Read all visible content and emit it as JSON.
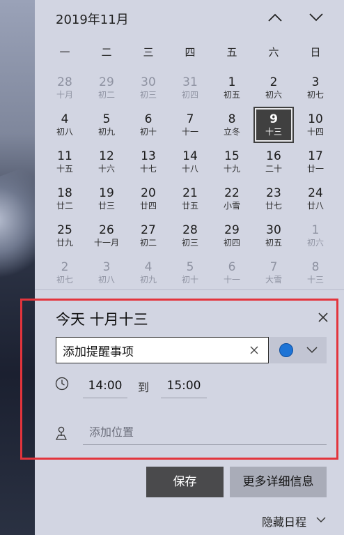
{
  "calendar": {
    "month_title": "2019年11月",
    "weekdays": [
      "一",
      "二",
      "三",
      "四",
      "五",
      "六",
      "日"
    ],
    "weeks": [
      [
        {
          "n": "28",
          "l": "十月",
          "o": true
        },
        {
          "n": "29",
          "l": "初二",
          "o": true
        },
        {
          "n": "30",
          "l": "初三",
          "o": true
        },
        {
          "n": "31",
          "l": "初四",
          "o": true
        },
        {
          "n": "1",
          "l": "初五"
        },
        {
          "n": "2",
          "l": "初六"
        },
        {
          "n": "3",
          "l": "初七"
        }
      ],
      [
        {
          "n": "4",
          "l": "初八"
        },
        {
          "n": "5",
          "l": "初九"
        },
        {
          "n": "6",
          "l": "初十"
        },
        {
          "n": "7",
          "l": "十一"
        },
        {
          "n": "8",
          "l": "立冬"
        },
        {
          "n": "9",
          "l": "十三",
          "today": true
        },
        {
          "n": "10",
          "l": "十四"
        }
      ],
      [
        {
          "n": "11",
          "l": "十五"
        },
        {
          "n": "12",
          "l": "十六"
        },
        {
          "n": "13",
          "l": "十七"
        },
        {
          "n": "14",
          "l": "十八"
        },
        {
          "n": "15",
          "l": "十九"
        },
        {
          "n": "16",
          "l": "二十"
        },
        {
          "n": "17",
          "l": "廿一"
        }
      ],
      [
        {
          "n": "18",
          "l": "廿二"
        },
        {
          "n": "19",
          "l": "廿三"
        },
        {
          "n": "20",
          "l": "廿四"
        },
        {
          "n": "21",
          "l": "廿五"
        },
        {
          "n": "22",
          "l": "小雪"
        },
        {
          "n": "23",
          "l": "廿七"
        },
        {
          "n": "24",
          "l": "廿八"
        }
      ],
      [
        {
          "n": "25",
          "l": "廿九"
        },
        {
          "n": "26",
          "l": "十一月"
        },
        {
          "n": "27",
          "l": "初二"
        },
        {
          "n": "28",
          "l": "初三"
        },
        {
          "n": "29",
          "l": "初四"
        },
        {
          "n": "30",
          "l": "初五"
        },
        {
          "n": "1",
          "l": "初六",
          "o": true
        }
      ],
      [
        {
          "n": "2",
          "l": "初七",
          "o": true
        },
        {
          "n": "3",
          "l": "初八",
          "o": true
        },
        {
          "n": "4",
          "l": "初九",
          "o": true
        },
        {
          "n": "5",
          "l": "初十",
          "o": true
        },
        {
          "n": "6",
          "l": "十一",
          "o": true
        },
        {
          "n": "7",
          "l": "大雪",
          "o": true
        },
        {
          "n": "8",
          "l": "十三",
          "o": true
        }
      ]
    ]
  },
  "event": {
    "title": "今天 十月十三",
    "reminder_value": "添加提醒事项",
    "color": "#1e74d6",
    "start_time": "14:00",
    "to_label": "到",
    "end_time": "15:00",
    "location_placeholder": "添加位置"
  },
  "buttons": {
    "save": "保存",
    "more_details": "更多详细信息",
    "hide_schedule": "隐藏日程"
  }
}
